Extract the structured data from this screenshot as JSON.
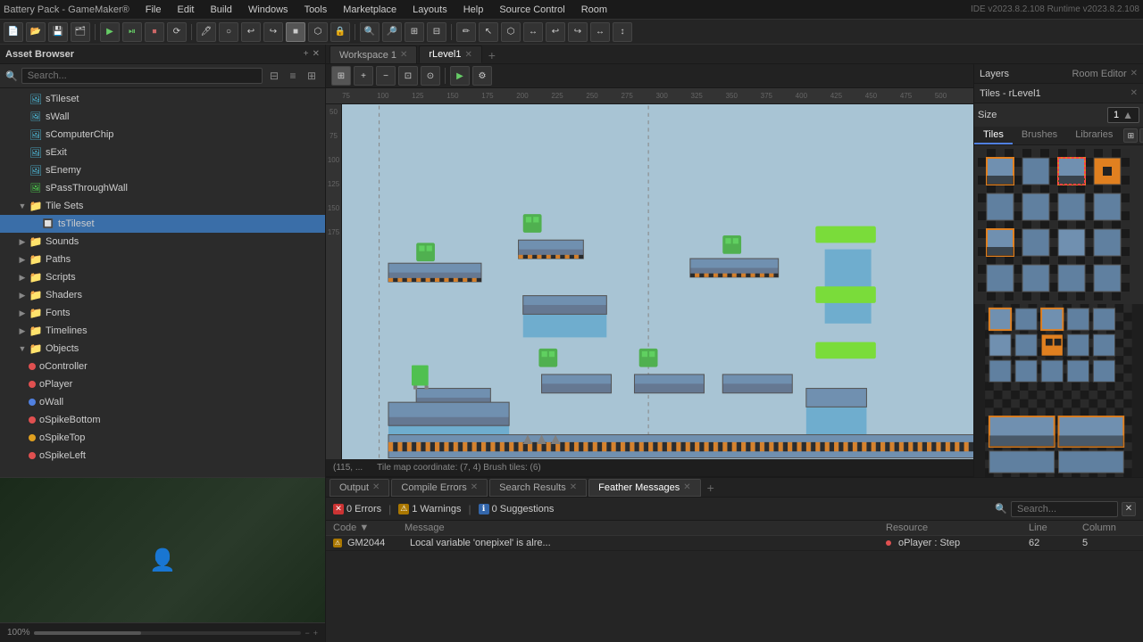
{
  "window": {
    "title": "Battery Pack - GameMaker®",
    "ide_version": "IDE v2023.8.2.108  Runtime v2023.8.2.108"
  },
  "menu_bar": {
    "items": [
      "File",
      "Edit",
      "Build",
      "Windows",
      "Tools",
      "Marketplace",
      "Layouts",
      "Help",
      "Source Control",
      "Room"
    ]
  },
  "asset_panel": {
    "title": "Asset Browser",
    "search_placeholder": "Search...",
    "tree": [
      {
        "id": "sTileset",
        "label": "sTileset",
        "type": "sprite",
        "indent": 1,
        "selected": false
      },
      {
        "id": "sWall",
        "label": "sWall",
        "type": "sprite_blue",
        "indent": 1,
        "selected": false
      },
      {
        "id": "sComputerChip",
        "label": "sComputerChip",
        "type": "sprite",
        "indent": 1,
        "selected": false
      },
      {
        "id": "sExit",
        "label": "sExit",
        "type": "sprite",
        "indent": 1,
        "selected": false
      },
      {
        "id": "sEnemy",
        "label": "sEnemy",
        "type": "sprite",
        "indent": 1,
        "selected": false
      },
      {
        "id": "sPassThroughWall",
        "label": "sPassThroughWall",
        "type": "sprite_green",
        "indent": 1,
        "selected": false
      },
      {
        "id": "TileSets",
        "label": "Tile Sets",
        "type": "folder",
        "indent": 0,
        "expanded": true,
        "selected": false
      },
      {
        "id": "tsTileset",
        "label": "tsTileset",
        "type": "tileset",
        "indent": 2,
        "selected": true
      },
      {
        "id": "Sounds",
        "label": "Sounds",
        "type": "folder",
        "indent": 0,
        "expanded": false,
        "selected": false
      },
      {
        "id": "Paths",
        "label": "Paths",
        "type": "folder",
        "indent": 0,
        "expanded": false,
        "selected": false
      },
      {
        "id": "Scripts",
        "label": "Scripts",
        "type": "folder",
        "indent": 0,
        "expanded": false,
        "selected": false
      },
      {
        "id": "Shaders",
        "label": "Shaders",
        "type": "folder",
        "indent": 0,
        "expanded": false,
        "selected": false
      },
      {
        "id": "Fonts",
        "label": "Fonts",
        "type": "folder",
        "indent": 0,
        "expanded": false,
        "selected": false
      },
      {
        "id": "Timelines",
        "label": "Timelines",
        "type": "folder",
        "indent": 0,
        "expanded": false,
        "selected": false
      },
      {
        "id": "Objects",
        "label": "Objects",
        "type": "folder",
        "indent": 0,
        "expanded": true,
        "selected": false
      },
      {
        "id": "oController",
        "label": "oController",
        "type": "obj_dot_red",
        "indent": 2,
        "selected": false
      },
      {
        "id": "oPlayer",
        "label": "oPlayer",
        "type": "obj_dot_red",
        "indent": 2,
        "selected": false
      },
      {
        "id": "oWall",
        "label": "oWall",
        "type": "obj_dot_blue",
        "indent": 2,
        "selected": false
      },
      {
        "id": "oSpikeBottom",
        "label": "oSpikeBottom",
        "type": "obj_dot_red",
        "indent": 2,
        "selected": false
      },
      {
        "id": "oSpikeTop",
        "label": "oSpikeTop",
        "type": "obj_dot_yellow",
        "indent": 2,
        "selected": false
      },
      {
        "id": "oSpikeLeft",
        "label": "oSpikeLeft",
        "type": "obj_dot_red",
        "indent": 2,
        "selected": false
      }
    ]
  },
  "tabs": {
    "workspace": "Workspace 1",
    "room": "rLevel1",
    "active": "rLevel1"
  },
  "room_editor": {
    "layers_label": "Layers",
    "room_editor_label": "Room Editor",
    "tiles_label": "Tiles - rLevel1",
    "rulers": [
      "75",
      "100",
      "125",
      "150",
      "175",
      "200",
      "225",
      "250",
      "275",
      "300",
      "325",
      "350",
      "375",
      "400",
      "425",
      "450",
      "475",
      "500"
    ]
  },
  "right_panel": {
    "header": "Tiles - rLevel1",
    "size_label": "Size",
    "tileset_number": "1",
    "tabs": [
      "Tiles",
      "Brushes",
      "Libraries"
    ]
  },
  "status_bar": {
    "coords": "(115, ...",
    "tile_info": "Tile map coordinate: (7, 4)  Brush tiles: (6)"
  },
  "bottom": {
    "tabs": [
      "Output",
      "Compile Errors",
      "Search Results",
      "Feather Messages"
    ],
    "active_tab": "Feather Messages",
    "errors_count": "0 Errors",
    "warnings_count": "1 Warnings",
    "suggestions_count": "0 Suggestions",
    "search_placeholder": "Search...",
    "columns": [
      "Code",
      "Message",
      "Resource",
      "Line",
      "Column"
    ],
    "rows": [
      {
        "code": "GM2044",
        "message": "Local variable 'onepixel' is alre...",
        "resource": "oPlayer : Step",
        "line": "62",
        "column": "5",
        "severity": "warning"
      }
    ]
  },
  "zoom": "100%"
}
